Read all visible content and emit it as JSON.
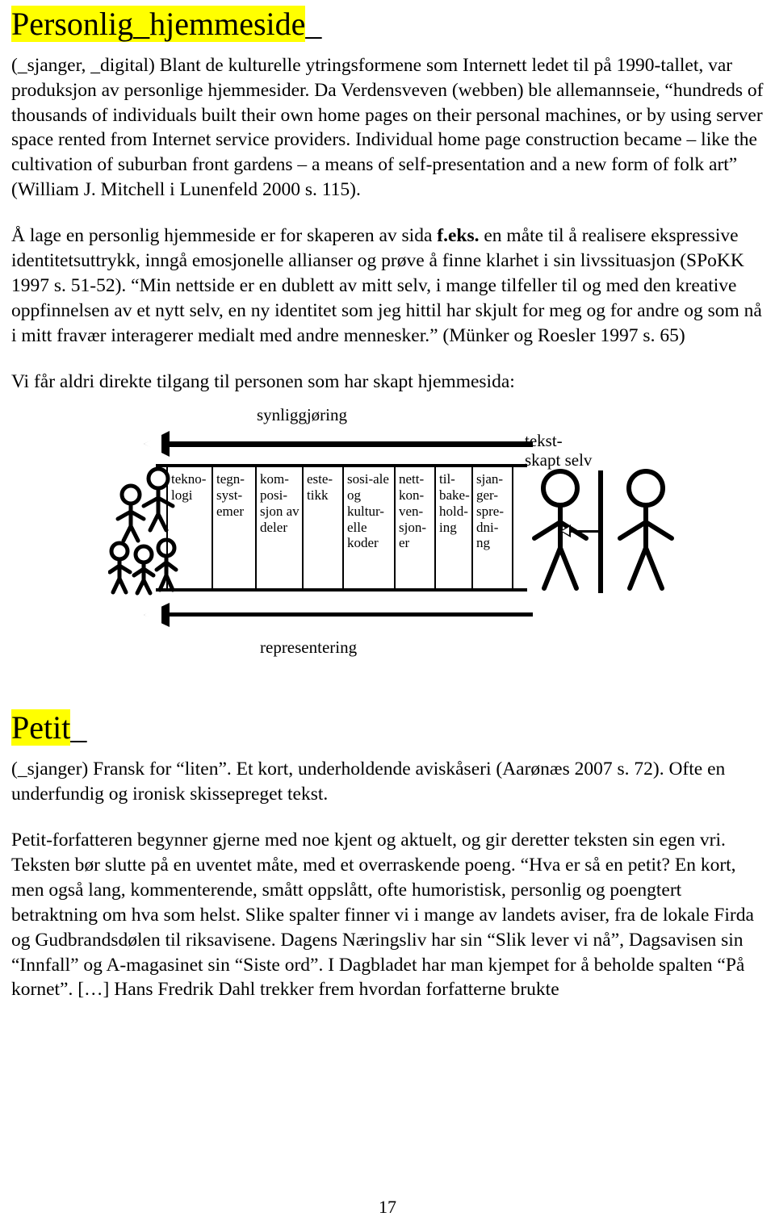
{
  "headings": {
    "section_1": {
      "highlight": "Personlig_hjemmeside",
      "trailing": "_"
    },
    "section_2": {
      "highlight": "Petit",
      "trailing": "_"
    }
  },
  "paragraphs": {
    "p1_a": "(_sjanger, _digital) Blant de kulturelle ytringsformene som Internett ledet til på 1990-tallet, var produksjon av personlige hjemmesider. Da Verdensveven (webben) ble allemannseie, “hundreds of thousands of individuals built their own home pages on their personal machines, or by using server space rented from Internet service providers. Individual home page construction became – like the cultivation of suburban front gardens – a means of self-presentation and a new form of folk art” (William J. Mitchell i Lunenfeld 2000 s. 115).",
    "p2_before": "Å lage en personlig hjemmeside er for skaperen av sida ",
    "p2_bold": "f.eks.",
    "p2_after": " en måte til å realisere ekspressive identitetsuttrykk, inngå emosjonelle allianser og prøve å finne klarhet i sin livssituasjon (SPoKK 1997 s. 51-52). “Min nettside er en dublett av mitt selv, i mange tilfeller til og med den kreative oppfinnelsen av et nytt selv, en ny identitet som jeg hittil har skjult for meg og for andre og som nå i mitt fravær interagerer medialt med andre mennesker.” (Münker og Roesler 1997 s. 65)",
    "p3": "Vi får aldri direkte tilgang til personen som har skapt hjemmesida:",
    "p4": "(_sjanger) Fransk for “liten”. Et kort, underholdende aviskåseri (Aarønæs 2007 s. 72). Ofte en underfundig og ironisk skissepreget tekst.",
    "p5": "Petit-forfatteren begynner gjerne med noe kjent og aktuelt, og gir deretter teksten sin egen vri. Teksten bør slutte på en uventet måte, med et overraskende poeng. “Hva er så en petit? En kort, men også lang, kommenterende, smått oppslått, ofte humoristisk, personlig og poengtert betraktning om hva som helst. Slike spalter finner vi i mange av landets aviser, fra de lokale Firda og Gudbrandsdølen til riksavisene. Dagens Næringsliv har sin “Slik lever vi nå”, Dagsavisen sin “Innfall” og A-magasinet sin “Siste ord”. I Dagbladet har man kjempet for å beholde spalten “På kornet”. […] Hans Fredrik Dahl trekker frem hvordan forfatterne brukte"
  },
  "diagram": {
    "label_top": "synliggjøring",
    "label_bottom": "representering",
    "label_right_line1": "tekst-",
    "label_right_line2": "skapt selv",
    "columns": [
      "tekno-logi",
      "tegn-syst-emer",
      "kom-posi-sjon av deler",
      "este-tikk",
      "sosi-ale og kultur-elle koder",
      "nett-kon-ven-sjon-er",
      "til-bake-hold-ing",
      "sjan-ger-spre-dni-ng"
    ],
    "left_figure_count": 5,
    "right_figure_count": 2
  },
  "footer": {
    "page_number": "17"
  },
  "colors": {
    "highlight": "#ffff00",
    "text": "#000000",
    "background": "#ffffff"
  }
}
